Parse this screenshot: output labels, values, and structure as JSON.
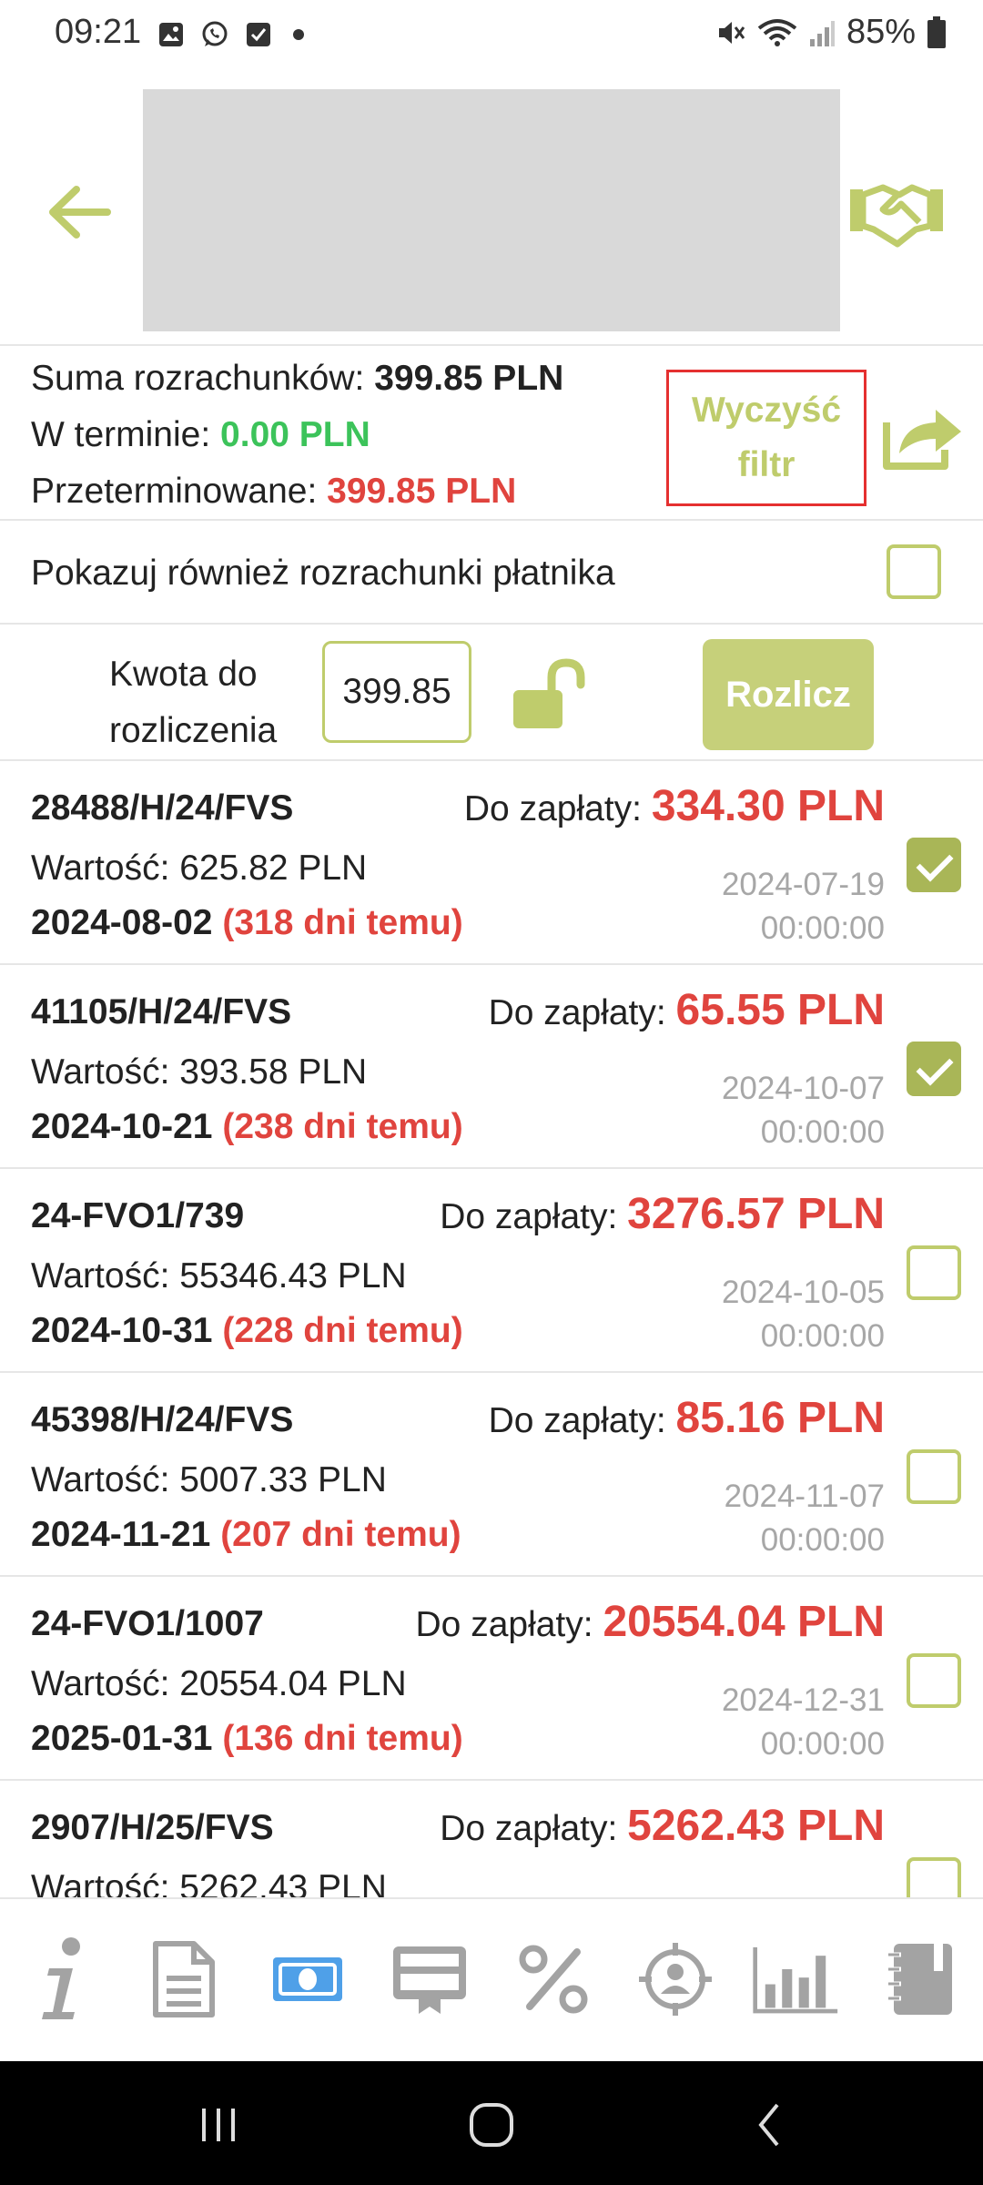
{
  "status_bar": {
    "time": "09:21",
    "battery": "85%"
  },
  "summary": {
    "total_label": "Suma rozrachunków:",
    "total_value": "399.85 PLN",
    "on_time_label": "W terminie:",
    "on_time_value": "0.00 PLN",
    "overdue_label": "Przeterminowane:",
    "overdue_value": "399.85 PLN",
    "clear_filter_label": "Wyczyść filtr"
  },
  "payer_row": {
    "label": "Pokazuj również rozrachunki płatnika",
    "checked": false
  },
  "amount_row": {
    "label_line1": "Kwota do",
    "label_line2": "rozliczenia",
    "value": "399.85",
    "settle_label": "Rozlicz"
  },
  "invoices": [
    {
      "number": "28488/H/24/FVS",
      "due_label": "Do zapłaty:",
      "due_amount": "334.30 PLN",
      "value": "Wartość: 625.82 PLN",
      "date": "2024-08-02",
      "days": "(318 dni temu)",
      "issued_date": "2024-07-19",
      "issued_time": "00:00:00",
      "checked": true
    },
    {
      "number": "41105/H/24/FVS",
      "due_label": "Do zapłaty:",
      "due_amount": "65.55 PLN",
      "value": "Wartość: 393.58 PLN",
      "date": "2024-10-21",
      "days": "(238 dni temu)",
      "issued_date": "2024-10-07",
      "issued_time": "00:00:00",
      "checked": true
    },
    {
      "number": "24-FVO1/739",
      "due_label": "Do zapłaty:",
      "due_amount": "3276.57 PLN",
      "value": "Wartość: 55346.43 PLN",
      "date": "2024-10-31",
      "days": "(228 dni temu)",
      "issued_date": "2024-10-05",
      "issued_time": "00:00:00",
      "checked": false
    },
    {
      "number": "45398/H/24/FVS",
      "due_label": "Do zapłaty:",
      "due_amount": "85.16 PLN",
      "value": "Wartość: 5007.33 PLN",
      "date": "2024-11-21",
      "days": "(207 dni temu)",
      "issued_date": "2024-11-07",
      "issued_time": "00:00:00",
      "checked": false
    },
    {
      "number": "24-FVO1/1007",
      "due_label": "Do zapłaty:",
      "due_amount": "20554.04 PLN",
      "value": "Wartość: 20554.04 PLN",
      "date": "2025-01-31",
      "days": "(136 dni temu)",
      "issued_date": "2024-12-31",
      "issued_time": "00:00:00",
      "checked": false
    },
    {
      "number": "2907/H/25/FVS",
      "due_label": "Do zapłaty:",
      "due_amount": "5262.43 PLN",
      "value": "Wartość: 5262.43 PLN",
      "date": "",
      "days": "",
      "issued_date": "",
      "issued_time": "",
      "checked": false
    }
  ],
  "bottom_nav": [
    {
      "icon": "info-icon",
      "active": false
    },
    {
      "icon": "document-icon",
      "active": false
    },
    {
      "icon": "banknote-icon",
      "active": true
    },
    {
      "icon": "invoice-card-icon",
      "active": false
    },
    {
      "icon": "percent-icon",
      "active": false
    },
    {
      "icon": "target-person-icon",
      "active": false
    },
    {
      "icon": "bar-chart-icon",
      "active": false
    },
    {
      "icon": "notebook-icon",
      "active": false
    }
  ],
  "colors": {
    "accent": "#bfcc6c",
    "danger": "#e0443e",
    "success": "#3cc35a",
    "nav_active": "#4fa0e8",
    "nav_inactive": "#a3a3a3"
  }
}
